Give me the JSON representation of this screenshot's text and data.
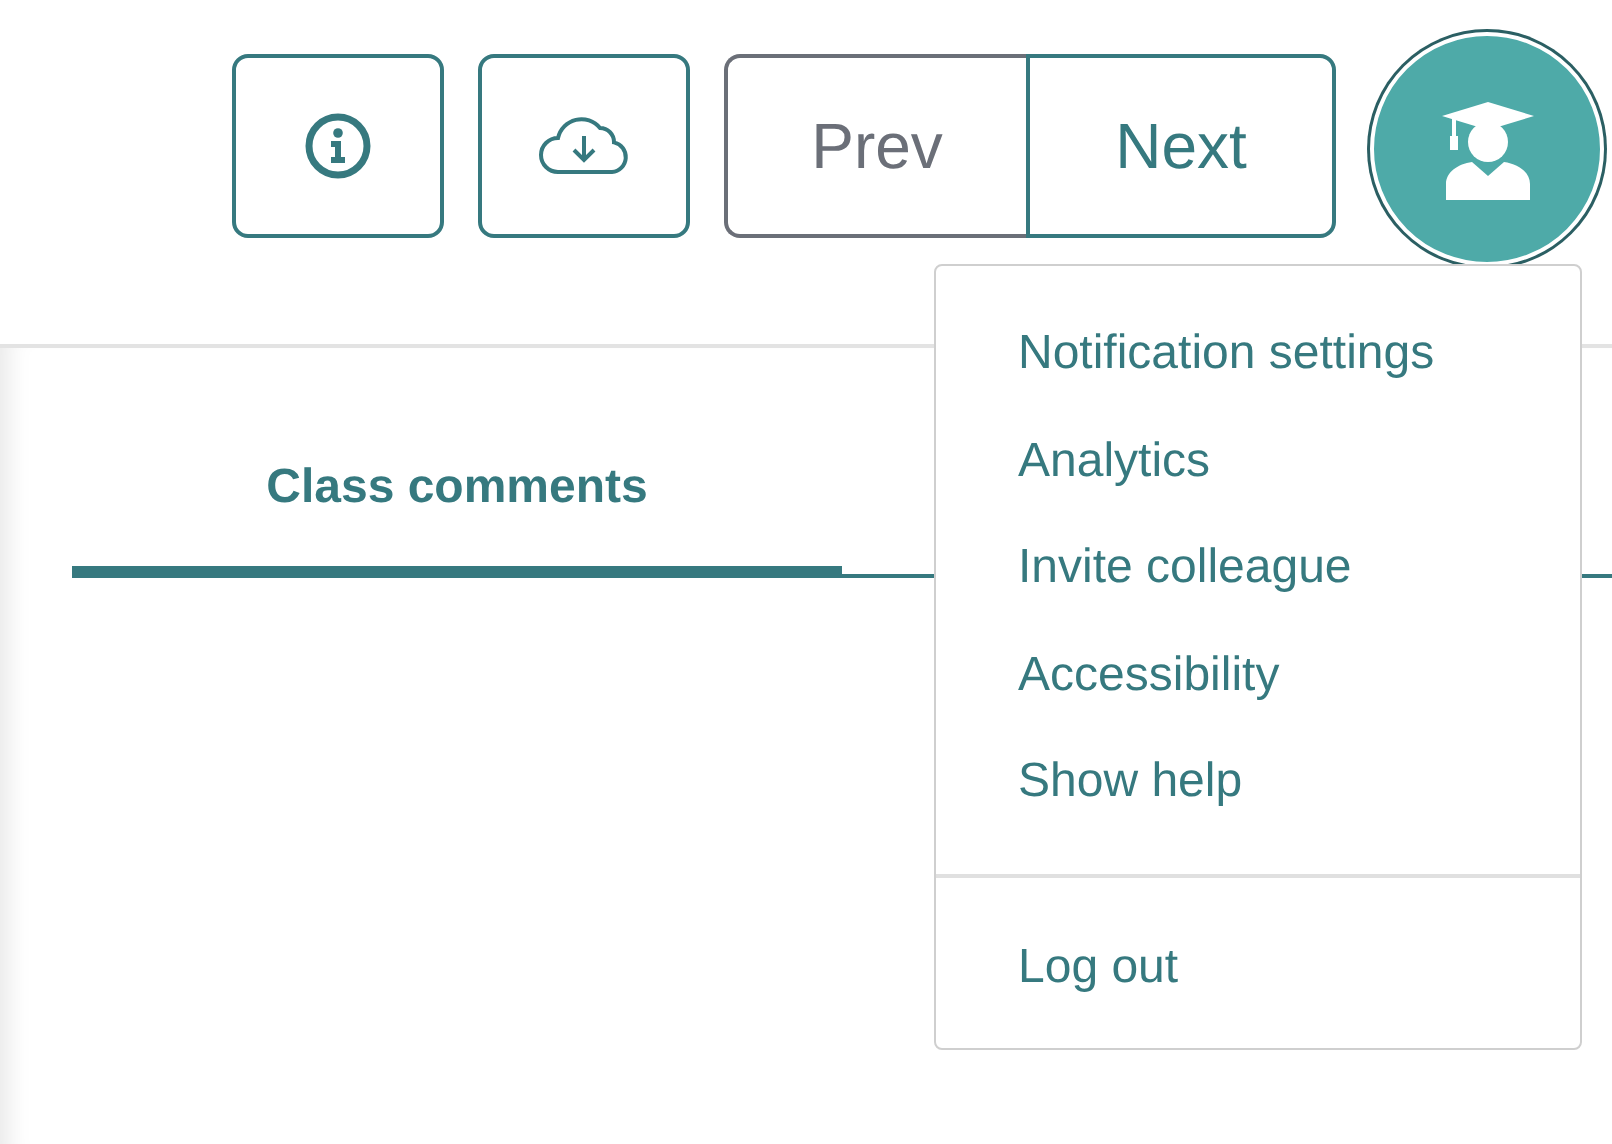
{
  "toolbar": {
    "icon_buttons": [
      {
        "kind": "info"
      },
      {
        "kind": "download"
      }
    ],
    "pager": [
      {
        "label": "Prev",
        "disabled": true
      },
      {
        "label": "Next",
        "disabled": false
      }
    ]
  },
  "tabs": [
    {
      "label": "Class comments",
      "selected": true
    }
  ],
  "user_menu": {
    "items": [
      "Notification settings",
      "Analytics",
      "Invite colleague",
      "Accessibility",
      "Show help"
    ],
    "footer_items": [
      "Log out"
    ]
  }
}
